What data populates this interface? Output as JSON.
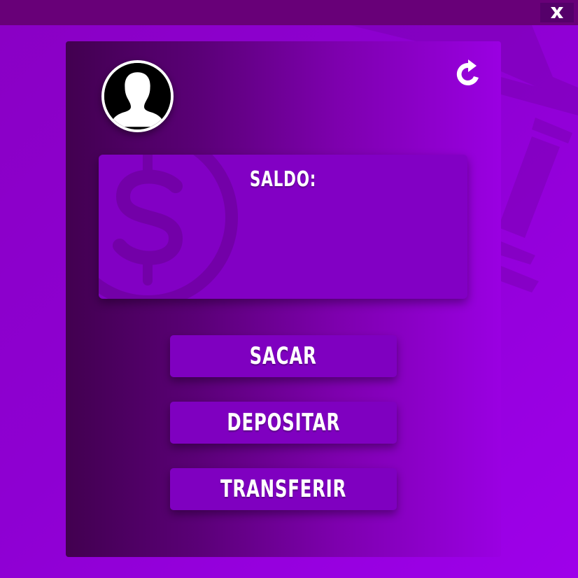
{
  "window": {
    "close_label": "X",
    "close_icon": "close-icon"
  },
  "header": {
    "avatar_icon": "user-silhouette-icon",
    "refresh_icon": "refresh-icon"
  },
  "balance": {
    "label": "SALDO:",
    "value": "",
    "watermark_icon": "dollar-coin-icon"
  },
  "actions": [
    {
      "label": "SACAR"
    },
    {
      "label": "DEPOSITAR"
    },
    {
      "label": "TRANSFERIR"
    }
  ],
  "colors": {
    "background": "#8e00d2",
    "topbar": "#680078",
    "panel_dark": "#420050",
    "card": "#8200c4",
    "button": "#7f00c0",
    "text": "#ffffff"
  }
}
